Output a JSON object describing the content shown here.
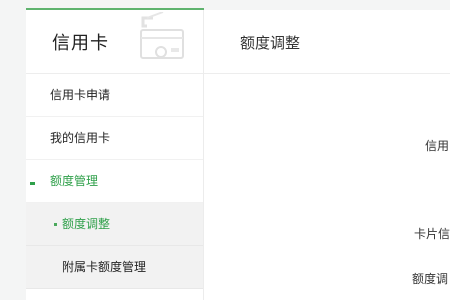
{
  "sidebar": {
    "title": "信用卡",
    "items": [
      {
        "label": "信用卡申请"
      },
      {
        "label": "我的信用卡"
      },
      {
        "label": "额度管理"
      },
      {
        "label": "额度调整"
      },
      {
        "label": "附属卡额度管理"
      }
    ]
  },
  "main": {
    "title": "额度调整",
    "form_labels": [
      "信用",
      "卡片信",
      "额度调"
    ]
  },
  "colors": {
    "accent": "#2fa04a",
    "accent_line": "#5fb36e"
  },
  "icons": {
    "header_icon": "credit-card-icon",
    "group_marker": "dash-marker",
    "active_marker": "dot-marker"
  }
}
